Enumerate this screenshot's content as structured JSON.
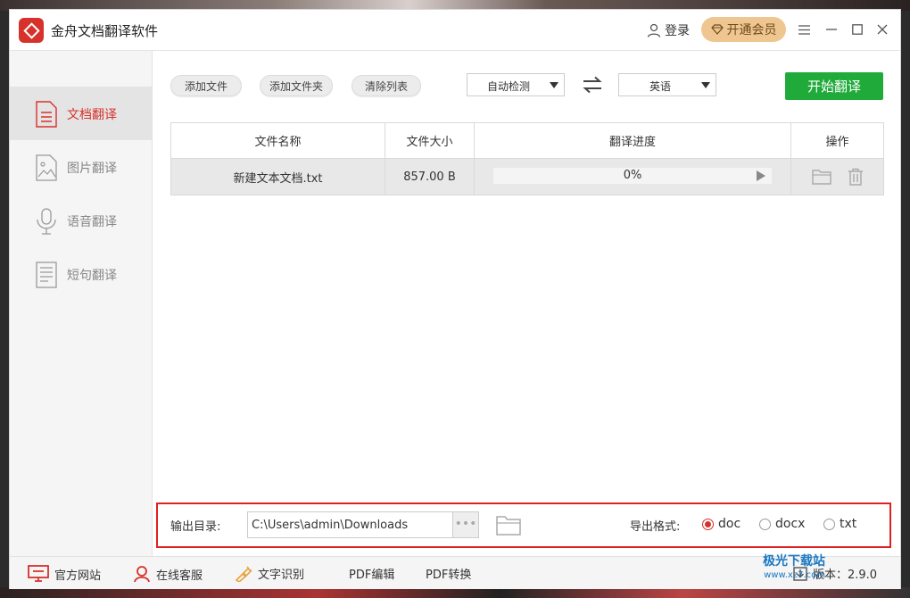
{
  "app": {
    "title": "金舟文档翻译软件"
  },
  "header": {
    "login_label": "登录",
    "vip_label": "开通会员"
  },
  "sidebar": {
    "items": [
      {
        "label": "文档翻译",
        "icon": "document-icon",
        "active": true
      },
      {
        "label": "图片翻译",
        "icon": "image-icon",
        "active": false
      },
      {
        "label": "语音翻译",
        "icon": "microphone-icon",
        "active": false
      },
      {
        "label": "短句翻译",
        "icon": "text-icon",
        "active": false
      }
    ]
  },
  "toolbar": {
    "add_file": "添加文件",
    "add_folder": "添加文件夹",
    "clear_list": "清除列表",
    "source_lang": "自动检测",
    "target_lang": "英语",
    "start": "开始翻译"
  },
  "table": {
    "columns": [
      "文件名称",
      "文件大小",
      "翻译进度",
      "操作"
    ],
    "rows": [
      {
        "name": "新建文本文档.txt",
        "size": "857.00 B",
        "progress_text": "0%",
        "progress": 0
      }
    ]
  },
  "output": {
    "dir_label": "输出目录:",
    "dir_value": "C:\\Users\\admin\\Downloads",
    "browse_label": "•••",
    "format_label": "导出格式:",
    "formats": [
      {
        "label": "doc",
        "selected": true
      },
      {
        "label": "docx",
        "selected": false
      },
      {
        "label": "txt",
        "selected": false
      }
    ]
  },
  "bottombar": {
    "official_site": "官方网站",
    "online_service": "在线客服",
    "ocr": "文字识别",
    "pdf_edit": "PDF编辑",
    "pdf_convert": "PDF转换",
    "version": "版本：2.9.0"
  },
  "watermark": {
    "main": "极光下载站",
    "sub": "www.xz7.com"
  },
  "colors": {
    "accent": "#d7312b",
    "primary_button": "#1faa3a",
    "vip": "#f0c690"
  }
}
